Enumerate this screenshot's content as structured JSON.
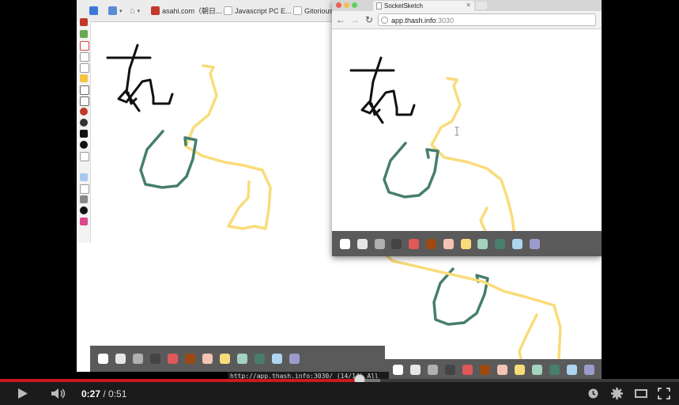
{
  "bookmarks": [
    {
      "label": "",
      "icon": "bookmark-icon-blue",
      "color": "#3c78d8"
    },
    {
      "label": "",
      "icon": "bookmark-icon-blue2",
      "color": "#5b8bd6"
    },
    {
      "label": "",
      "icon": "tag-icon",
      "color": "#777777"
    },
    {
      "label": "asahi.com（朝日...",
      "icon": "asahi-icon",
      "color": "#c0392b"
    },
    {
      "label": "Javascript PC E...",
      "icon": "page-icon",
      "color": "#bbbbbb"
    },
    {
      "label": "Gitorious",
      "icon": "page-icon",
      "color": "#bbbbbb"
    }
  ],
  "right_window": {
    "tab_title": "SocketSketch",
    "url_host": "app.thash.info",
    "url_port": ":3030"
  },
  "palette_colors": [
    "#ffffff",
    "#e6e6e6",
    "#b0b0b0",
    "#444444",
    "#e0585a",
    "#9c4a12",
    "#f3c4b4",
    "#f9dc7a",
    "#a2d3bf",
    "#477e6c",
    "#aed4f0",
    "#9c9ccc"
  ],
  "status_url": "http://app.thash.info:3030/ (14/14) All",
  "player": {
    "current_time": "0:27",
    "separator": " / ",
    "duration": "0:51",
    "progress_fraction": 0.53,
    "buffered_fraction": 0.56
  },
  "stroke_colors": {
    "black": "#111111",
    "yellow": "#f9dc7a",
    "green": "#477e6c"
  }
}
